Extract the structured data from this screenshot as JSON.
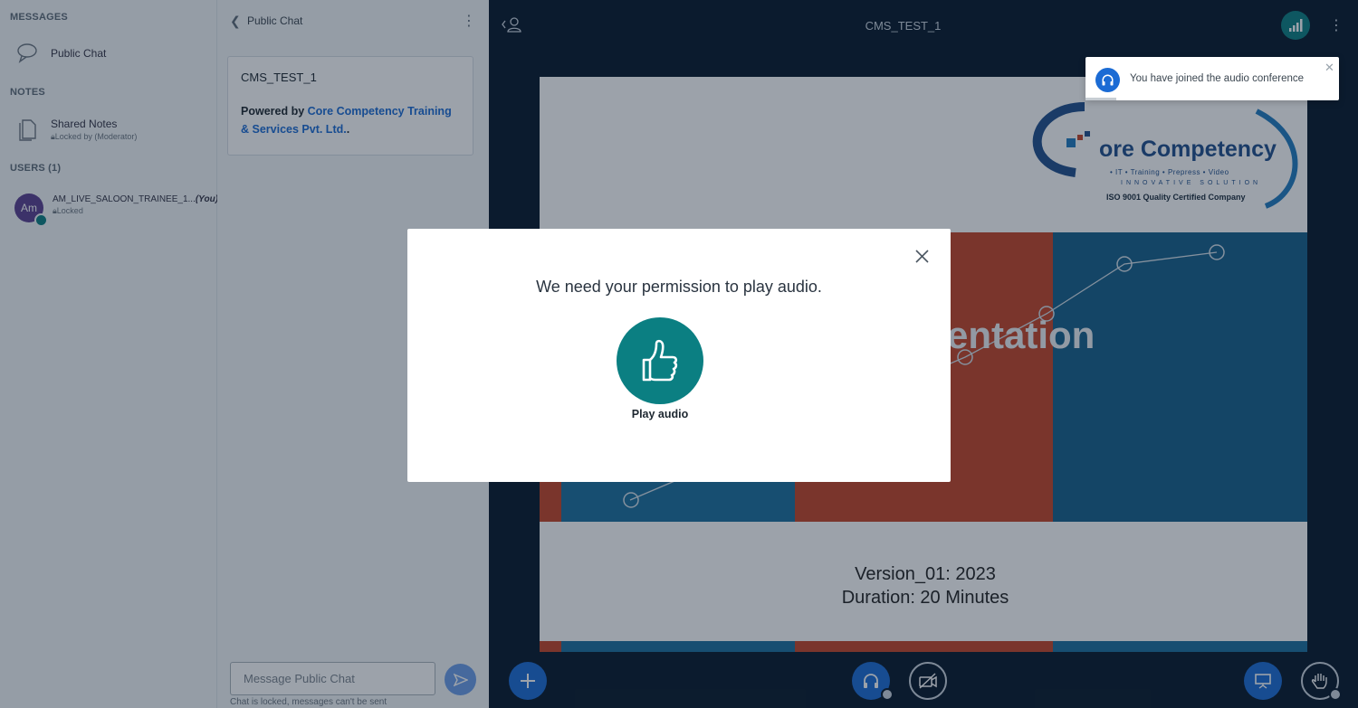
{
  "userlist": {
    "messages_title": "MESSAGES",
    "public_chat_label": "Public Chat",
    "notes_title": "NOTES",
    "shared_notes_label": "Shared Notes",
    "shared_notes_sub": "Locked by (Moderator)",
    "users_title": "USERS (1)",
    "user": {
      "initials": "Am",
      "name": "AM_LIVE_SALOON_TRAINEE_1...",
      "you": "(You)",
      "status": "Locked"
    }
  },
  "chat": {
    "title": "Public Chat",
    "welcome_title": "CMS_TEST_1",
    "welcome_powered": "Powered by ",
    "welcome_company": "Core Competency Training & Services Pvt. Ltd.",
    "welcome_suffix": ".",
    "input_placeholder": "Message Public Chat",
    "locked_text": "Chat is locked, messages can't be sent"
  },
  "main": {
    "title": "CMS_TEST_1",
    "slide": {
      "logo_name": "ore Competency",
      "logo_tags": "• IT   • Training   • Prepress   • Video",
      "logo_innov": "INNOVATIVE SOLUTION",
      "logo_iso": "ISO 9001 Quality Certified Company",
      "heading": "entation",
      "version": "Version_01: 2023",
      "duration": "Duration: 20 Minutes"
    }
  },
  "toast": {
    "text": "You have joined the audio conference"
  },
  "modal": {
    "title": "We need your permission to play audio.",
    "play_label": "Play audio"
  },
  "colors": {
    "accent_teal": "#0b7f82",
    "primary_blue": "#1b6bd4",
    "background": "#06172a"
  }
}
